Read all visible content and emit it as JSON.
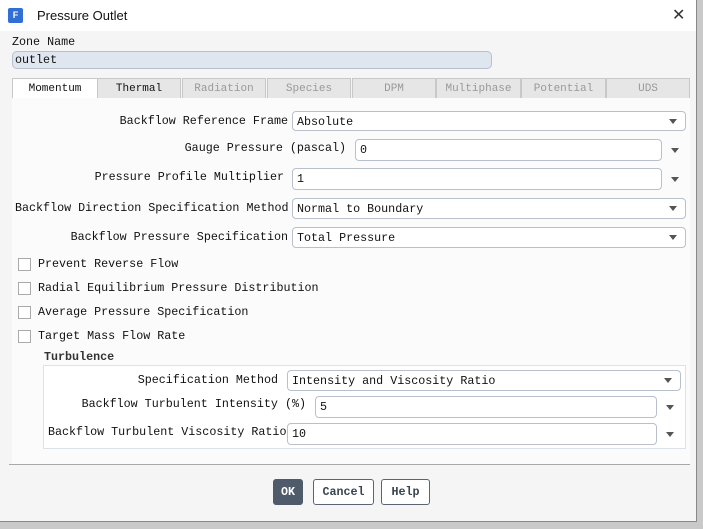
{
  "window": {
    "title": "Pressure Outlet",
    "icon": "fluent-app-icon",
    "close": "✕"
  },
  "zone": {
    "label": "Zone Name",
    "value": "outlet"
  },
  "tabs": [
    {
      "label": "Momentum",
      "active": true,
      "enabled": true
    },
    {
      "label": "Thermal",
      "enabled": true
    },
    {
      "label": "Radiation",
      "enabled": false
    },
    {
      "label": "Species",
      "enabled": false
    },
    {
      "label": "DPM",
      "enabled": false
    },
    {
      "label": "Multiphase",
      "enabled": false
    },
    {
      "label": "Potential",
      "enabled": false
    },
    {
      "label": "UDS",
      "enabled": false
    }
  ],
  "momentum": {
    "backflow_ref_frame": {
      "label": "Backflow Reference Frame",
      "value": "Absolute"
    },
    "gauge_pressure": {
      "label": "Gauge Pressure (pascal)",
      "value": "0"
    },
    "profile_multiplier": {
      "label": "Pressure Profile Multiplier",
      "value": "1"
    },
    "backflow_direction": {
      "label": "Backflow Direction Specification Method",
      "value": "Normal to Boundary"
    },
    "backflow_pressure": {
      "label": "Backflow Pressure Specification",
      "value": "Total Pressure"
    },
    "checkboxes": [
      {
        "label": "Prevent Reverse Flow",
        "checked": false
      },
      {
        "label": "Radial Equilibrium Pressure Distribution",
        "checked": false
      },
      {
        "label": "Average Pressure Specification",
        "checked": false
      },
      {
        "label": "Target Mass Flow Rate",
        "checked": false
      }
    ]
  },
  "turbulence": {
    "title": "Turbulence",
    "spec_method": {
      "label": "Specification Method",
      "value": "Intensity and Viscosity Ratio"
    },
    "intensity": {
      "label": "Backflow Turbulent Intensity (%)",
      "value": "5"
    },
    "viscosity_ratio": {
      "label": "Backflow Turbulent Viscosity Ratio",
      "value": "10"
    }
  },
  "buttons": {
    "ok": "OK",
    "cancel": "Cancel",
    "help": "Help"
  },
  "colors": {
    "ok_bg": "#4f5b6b",
    "zone_input_bg": "#dfe6ef"
  }
}
